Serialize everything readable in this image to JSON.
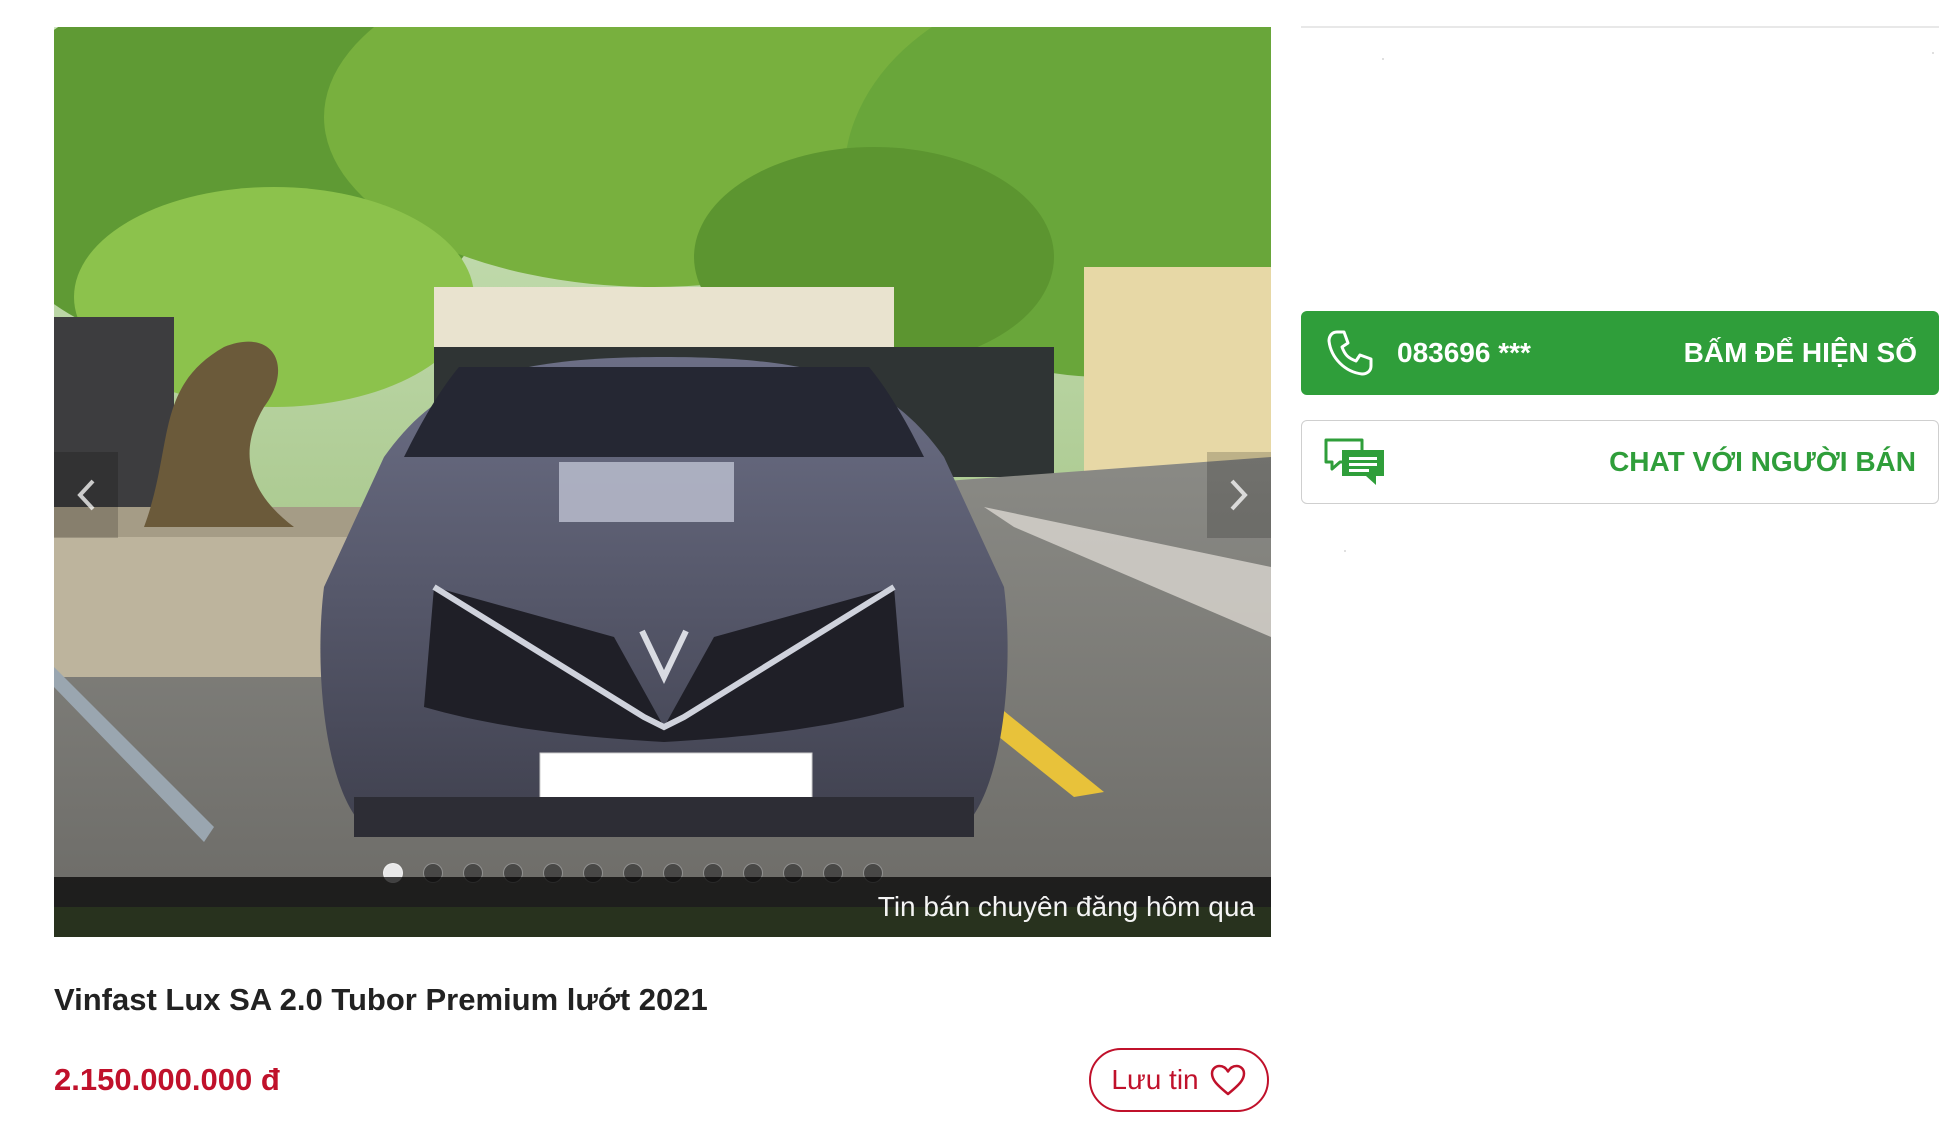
{
  "gallery": {
    "caption": "Tin bán chuyên đăng hôm qua",
    "dot_count": 13,
    "active_dot": 0,
    "prev_icon": "chevron-left-icon",
    "next_icon": "chevron-right-icon"
  },
  "listing": {
    "title": "Vinfast Lux SA 2.0 Tubor Premium lướt 2021",
    "price": "2.150.000.000 đ",
    "save_label": "Lưu tin",
    "save_icon": "heart-icon"
  },
  "contact": {
    "phone_masked": "083696 ***",
    "phone_cta": "BẤM ĐỂ HIỆN SỐ",
    "phone_icon": "phone-icon",
    "chat_cta": "CHAT VỚI NGƯỜI BÁN",
    "chat_icon": "chat-bubble-icon"
  },
  "colors": {
    "green": "#2f9e3a",
    "price_red": "#c0112b"
  }
}
